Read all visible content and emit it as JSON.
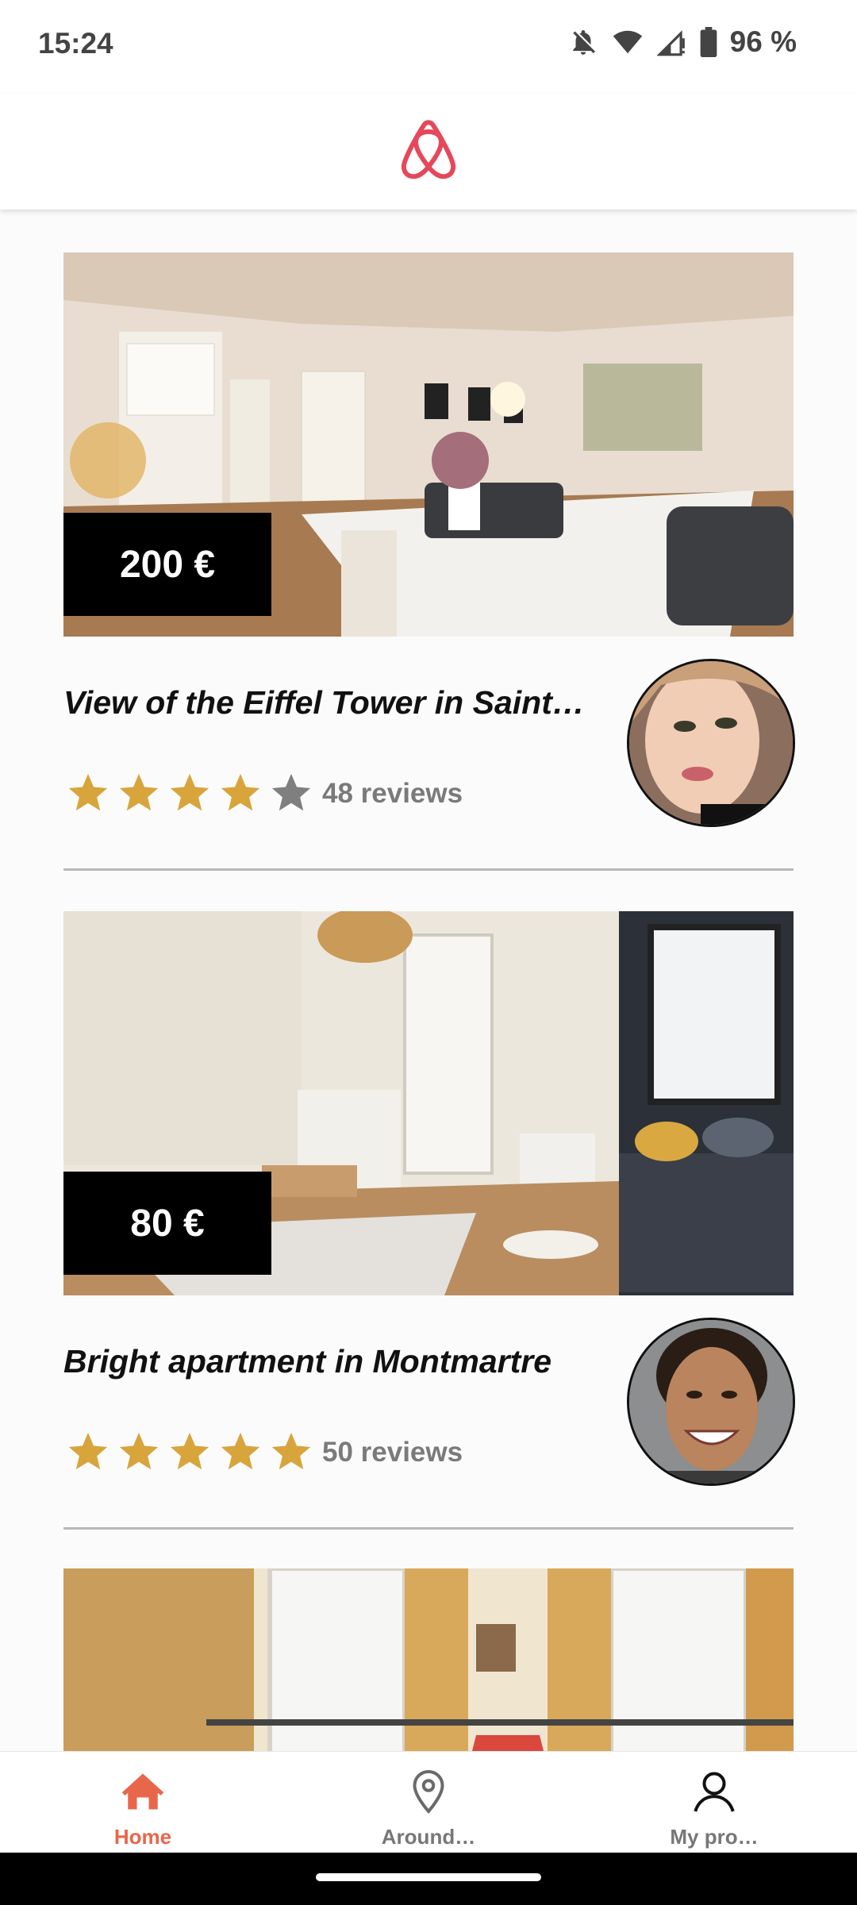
{
  "status_bar": {
    "time": "15:24",
    "battery": "96 %"
  },
  "header": {
    "logo": "airbnb-logo",
    "brand_color": "#E5485A"
  },
  "listings": [
    {
      "price": "200 €",
      "title": "View of the Eiffel Tower in Saint…",
      "rating": 4,
      "max_rating": 5,
      "reviews": "48 reviews"
    },
    {
      "price": "80 €",
      "title": "Bright apartment in Montmartre",
      "rating": 5,
      "max_rating": 5,
      "reviews": "50 reviews"
    }
  ],
  "colors": {
    "star_filled": "#D8A53C",
    "star_empty": "#7f7f7f",
    "accent": "#E8674A"
  },
  "nav": {
    "items": [
      {
        "label": "Home",
        "icon": "home-icon",
        "active": true
      },
      {
        "label": "Around…",
        "icon": "location-pin-icon",
        "active": false
      },
      {
        "label": "My pro…",
        "icon": "profile-icon",
        "active": false
      }
    ]
  }
}
